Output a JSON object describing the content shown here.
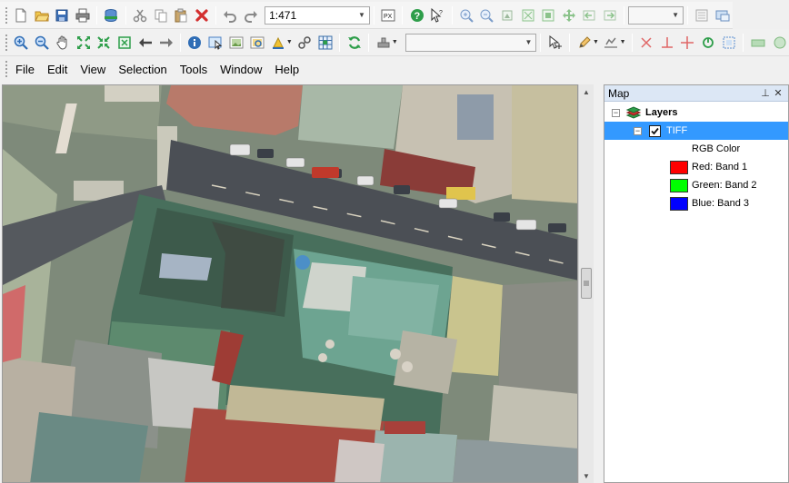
{
  "toolbar1": {
    "scale_value": "1:471",
    "icons": [
      "new-file-icon",
      "open-folder-icon",
      "save-icon",
      "print-icon",
      "database-icon",
      "cut-icon",
      "copy-icon",
      "paste-icon",
      "delete-icon",
      "undo-icon",
      "redo-icon",
      "pixel-icon",
      "help-icon",
      "whats-this-icon",
      "zoom-in-fixed-icon",
      "zoom-out-fixed-icon",
      "zoom-layer-icon",
      "zoom-full-icon",
      "zoom-selected-icon",
      "pan-center-icon",
      "previous-extent-icon",
      "next-extent-icon",
      "display-icon",
      "overview-icon"
    ]
  },
  "toolbar2": {
    "icons": [
      "zoom-in-icon",
      "zoom-out-icon",
      "pan-hand-icon",
      "full-extent-icon",
      "zoom-extent-icon",
      "zoom-window-icon",
      "back-arrow-icon",
      "forward-arrow-icon",
      "identify-icon",
      "select-features-icon",
      "image-icon",
      "image-select-icon",
      "fill-icon",
      "link-icon",
      "grid-icon",
      "refresh-icon",
      "stamp-icon",
      "vertex-edit-icon",
      "pencil-icon",
      "sketch-icon",
      "cross-icon",
      "perpendicular-icon",
      "crosshair-icon",
      "rotate-icon",
      "extent-box-icon",
      "layer-icon",
      "toggle-icon"
    ],
    "layer_combo_value": ""
  },
  "menu": [
    "File",
    "Edit",
    "View",
    "Selection",
    "Tools",
    "Window",
    "Help"
  ],
  "panel": {
    "title": "Map",
    "root_label": "Layers",
    "layer_name": "TIFF",
    "render_type": "RGB Color",
    "bands": [
      {
        "label": "Red: Band 1",
        "color": "#ff0000"
      },
      {
        "label": "Green: Band 2",
        "color": "#00ff00"
      },
      {
        "label": "Blue: Band 3",
        "color": "#0000ff"
      }
    ],
    "selected_bg": "#3399ff"
  }
}
